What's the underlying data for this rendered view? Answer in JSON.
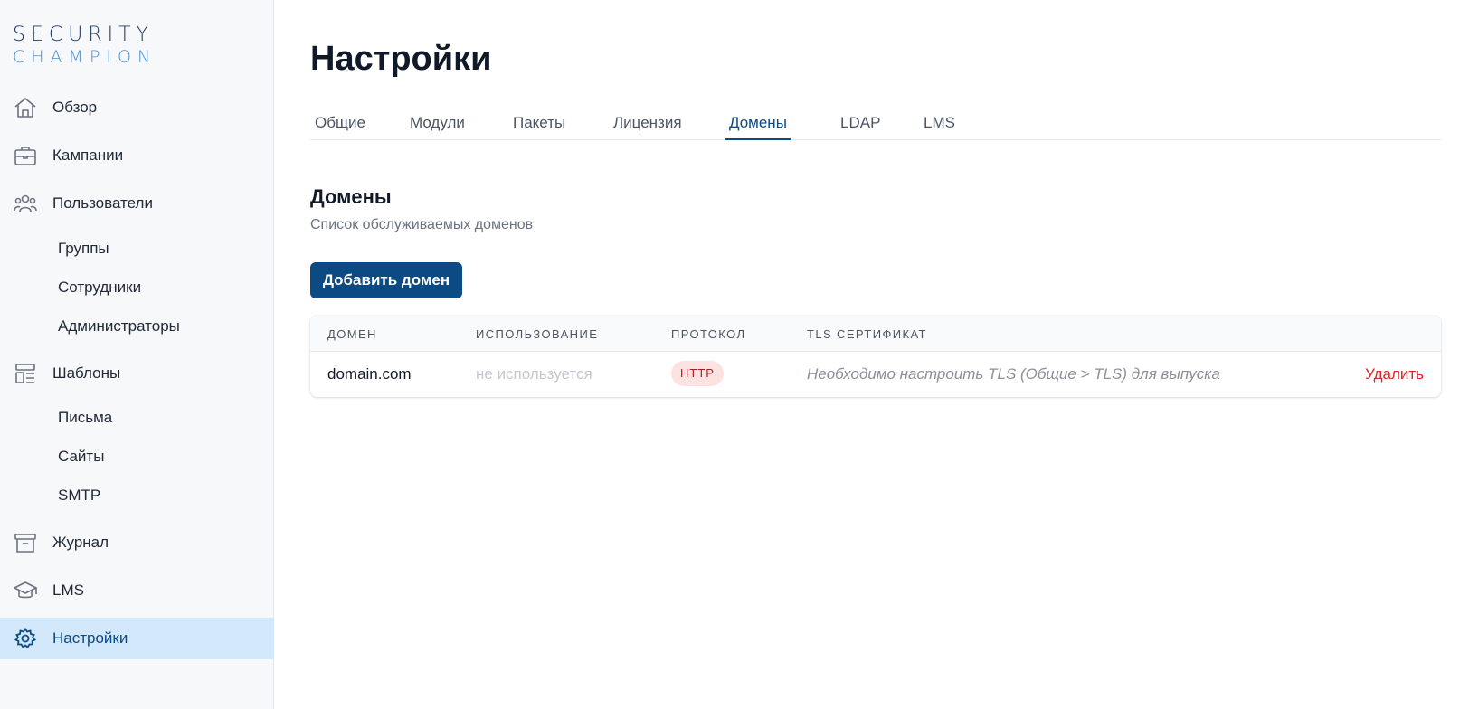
{
  "brand": {
    "line1": "SECURITY",
    "line2": "CHAMPION"
  },
  "sidebar": {
    "items": [
      {
        "label": "Обзор",
        "icon": "home-icon"
      },
      {
        "label": "Кампании",
        "icon": "briefcase-icon"
      },
      {
        "label": "Пользователи",
        "icon": "users-icon"
      },
      {
        "label": "Группы"
      },
      {
        "label": "Сотрудники"
      },
      {
        "label": "Администраторы"
      },
      {
        "label": "Шаблоны",
        "icon": "templates-icon"
      },
      {
        "label": "Письма"
      },
      {
        "label": "Сайты"
      },
      {
        "label": "SMTP"
      },
      {
        "label": "Журнал",
        "icon": "archive-icon"
      },
      {
        "label": "LMS",
        "icon": "graduation-cap-icon"
      },
      {
        "label": "Настройки",
        "icon": "gear-icon",
        "active": true
      }
    ]
  },
  "page": {
    "title": "Настройки"
  },
  "tabs": [
    {
      "label": "Общие"
    },
    {
      "label": "Модули"
    },
    {
      "label": "Пакеты"
    },
    {
      "label": "Лицензия"
    },
    {
      "label": "Домены",
      "active": true
    },
    {
      "label": "LDAP"
    },
    {
      "label": "LMS"
    }
  ],
  "section": {
    "title": "Домены",
    "subtitle": "Список обслуживаемых доменов",
    "add_button": "Добавить домен"
  },
  "table": {
    "headers": [
      "ДОМЕН",
      "ИСПОЛЬЗОВАНИЕ",
      "ПРОТОКОЛ",
      "TLS СЕРТИФИКАТ"
    ],
    "rows": [
      {
        "domain": "domain.com",
        "usage": "не используется",
        "protocol": "HTTP",
        "tls": "Необходимо настроить TLS (Общие > TLS) для выпуска",
        "action": "Удалить"
      }
    ]
  },
  "colors": {
    "accent": "#0b4a82",
    "active_bg": "#d3e8fb",
    "danger": "#dc2626",
    "badge_bg": "#fde2e2",
    "sidebar_bg": "#f7f8fa"
  }
}
